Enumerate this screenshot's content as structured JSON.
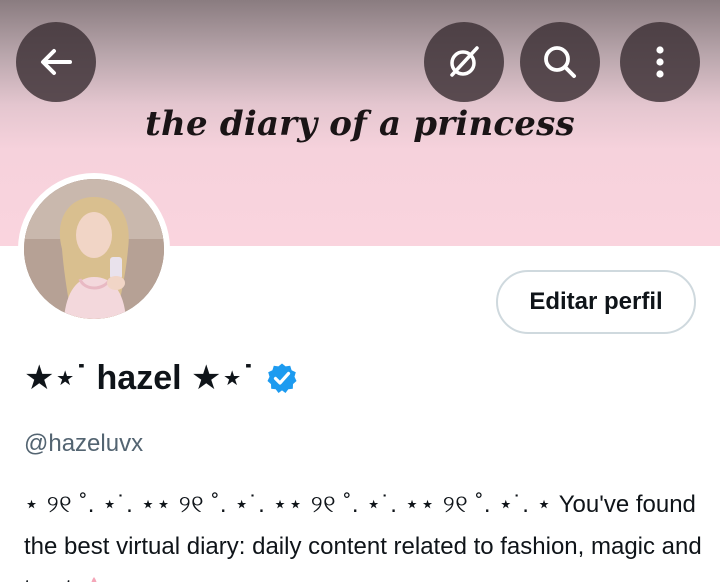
{
  "banner": {
    "title": "the diary of a princess"
  },
  "header_actions": {
    "back_icon": "arrow-left-icon",
    "grok_icon": "grok-icon",
    "search_icon": "search-icon",
    "more_icon": "more-vertical-icon"
  },
  "profile": {
    "display_name": "★⋆˙ hazel ★⋆˙",
    "verified": true,
    "handle": "@hazeluvx",
    "edit_label": "Editar perfil",
    "bio_decor": "⋆ ୨୧ ˚. ⋆˙. ⋆⋆ ୨୧ ˚. ⋆˙. ⋆⋆ ୨୧ ˚. ⋆˙. ⋆⋆ ୨୧ ˚. ⋆˙. ⋆",
    "bio_text": " You've found the best virtual diary: daily content related to fashion, magic and tarot",
    "bio_emoji": "lotus-icon"
  },
  "colors": {
    "banner_pink": "#fad4de",
    "verified_blue": "#1d9bf0",
    "secondary_text": "#536471",
    "border": "#cfd9de"
  }
}
